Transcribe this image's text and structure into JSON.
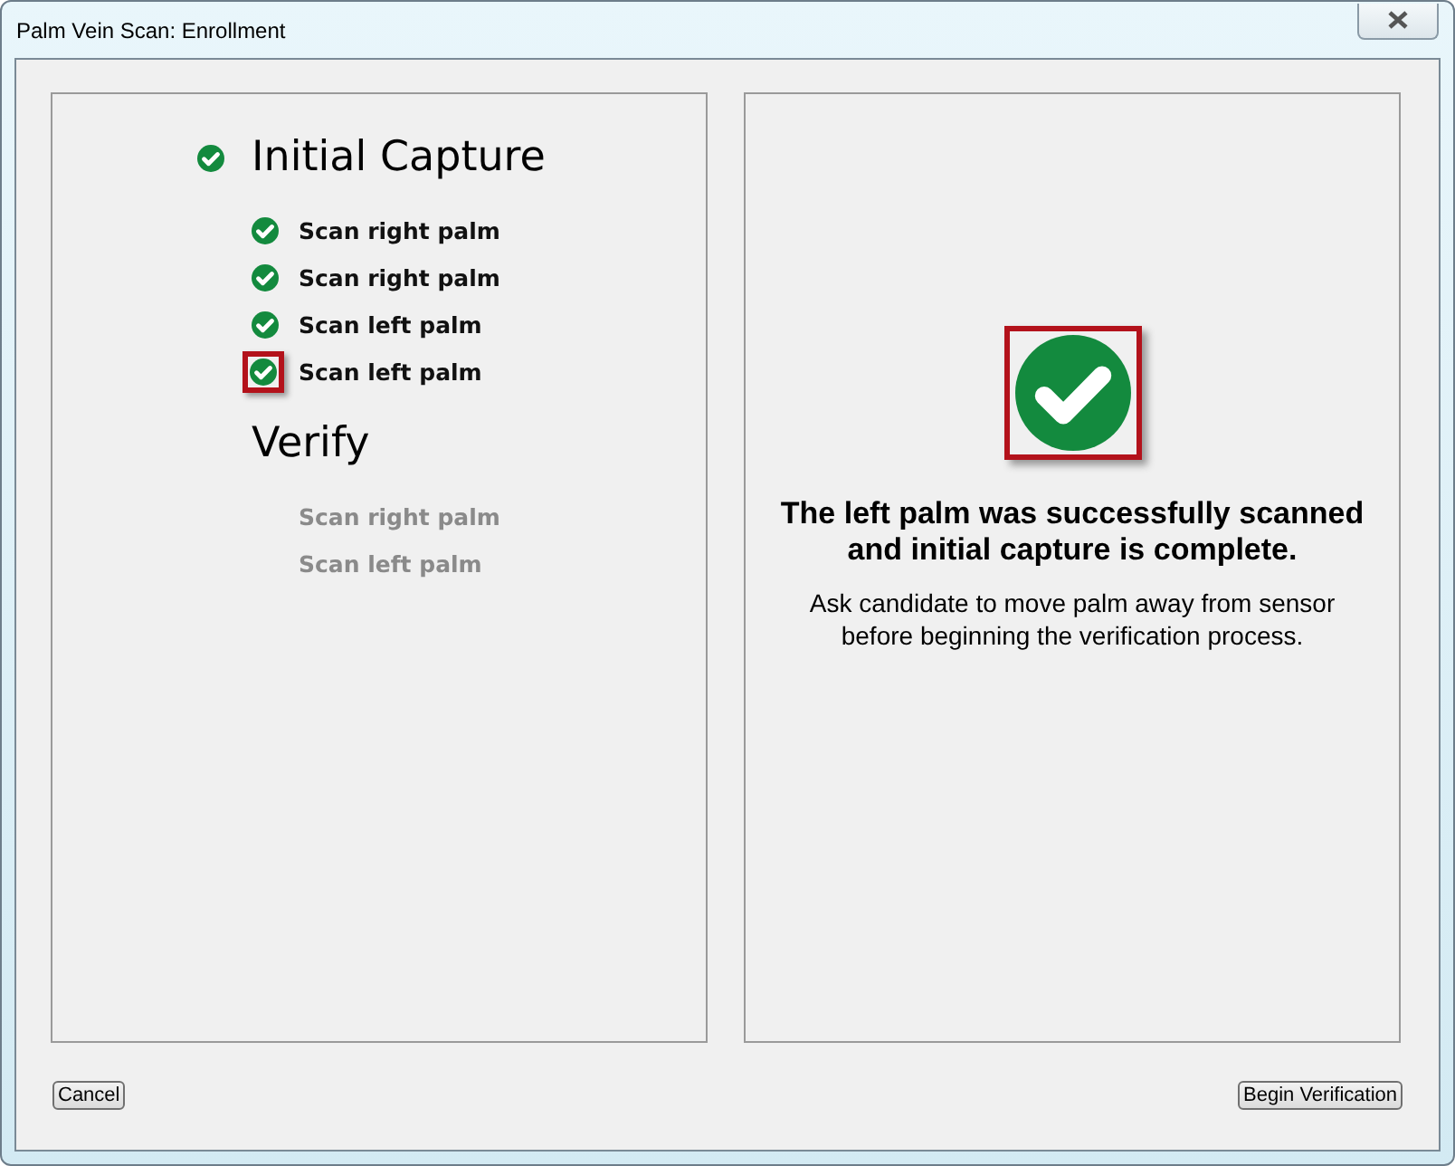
{
  "window": {
    "title": "Palm Vein Scan: Enrollment"
  },
  "steps": [
    {
      "label": "Initial Capture",
      "done": true,
      "children": [
        {
          "label": "Scan right palm",
          "done": true,
          "highlighted": false
        },
        {
          "label": "Scan right palm",
          "done": true,
          "highlighted": false
        },
        {
          "label": "Scan left palm",
          "done": true,
          "highlighted": false
        },
        {
          "label": "Scan left palm",
          "done": true,
          "highlighted": true
        }
      ]
    },
    {
      "label": "Verify",
      "done": false,
      "children": [
        {
          "label": "Scan right palm",
          "done": false
        },
        {
          "label": "Scan left palm",
          "done": false
        }
      ]
    }
  ],
  "result": {
    "complete": true,
    "highlighted": true,
    "heading": "The left palm was successfully scanned and initial capture is complete.",
    "message": "Ask candidate to move palm away from sensor before beginning the verification process."
  },
  "buttons": {
    "left": "Cancel",
    "right": "Begin Verification"
  }
}
